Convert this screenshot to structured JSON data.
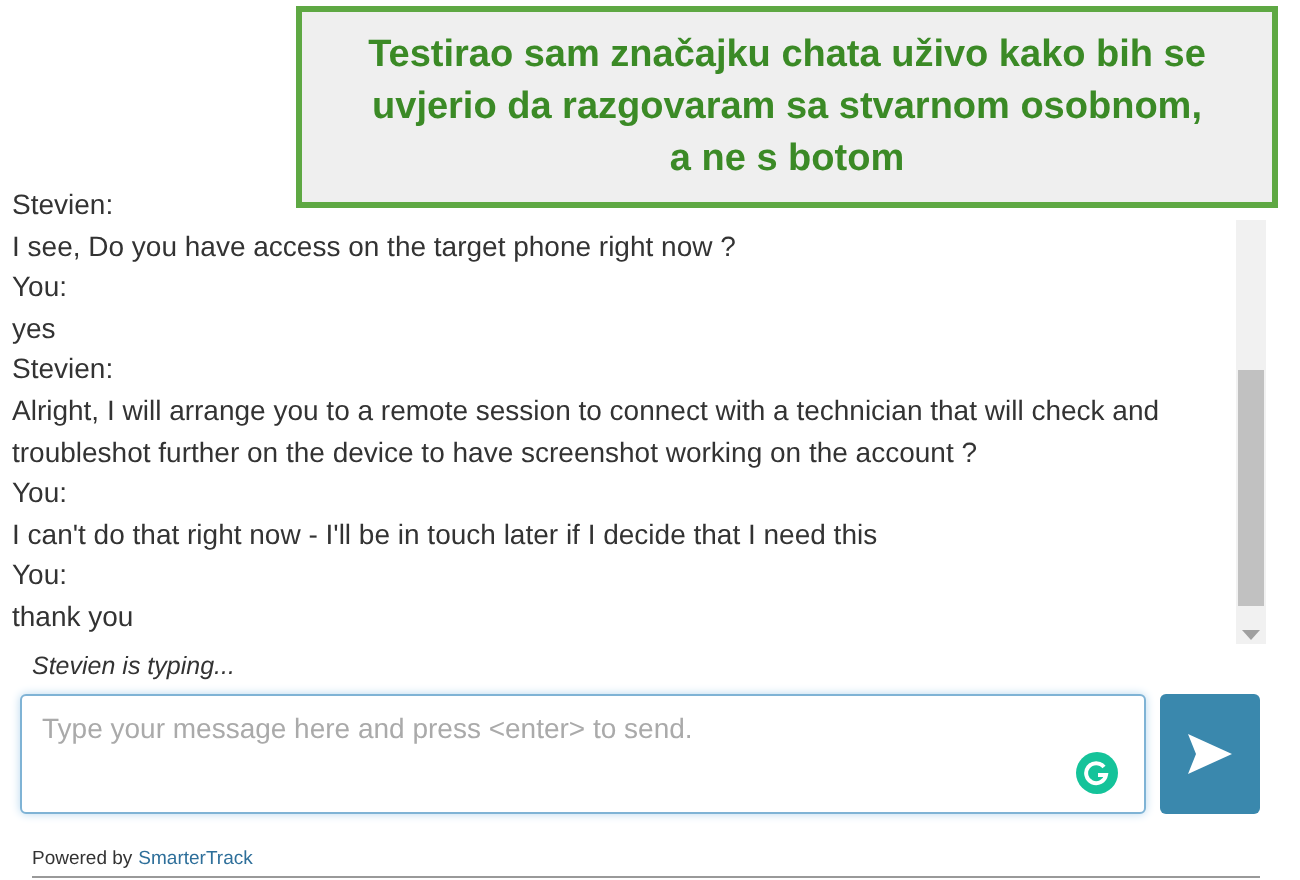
{
  "callout": {
    "text": "Testirao sam značajku chata uživo kako bih se uvjerio da razgovaram sa stvarnom osobnom, a ne s botom"
  },
  "messages": [
    {
      "sender": "Stevien:",
      "text": "I see, Do you have access on the target phone right now ?"
    },
    {
      "sender": "You:",
      "text": "yes"
    },
    {
      "sender": "Stevien:",
      "text": "Alright, I will arrange you to a remote session to connect with a technician that will check and troubleshot further on the device to have screenshot working on the account ?"
    },
    {
      "sender": "You:",
      "text": "I can't do that right now - I'll be in touch later if I decide that I need this"
    },
    {
      "sender": "You:",
      "text": "thank you"
    }
  ],
  "typing_status": "Stevien is typing...",
  "message_field": {
    "placeholder": "Type your message here and press <enter> to send."
  },
  "footer": {
    "prefix": "Powered by",
    "link": "SmarterTrack"
  }
}
